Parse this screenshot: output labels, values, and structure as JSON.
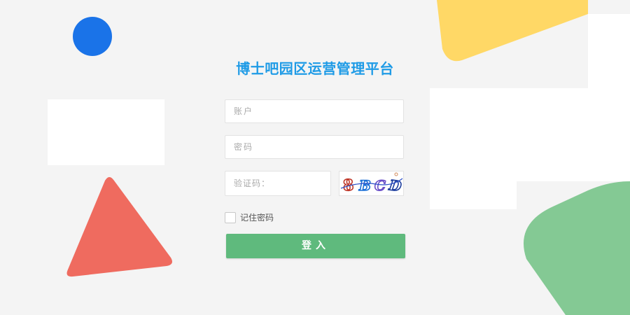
{
  "page": {
    "title": "博士吧园区运营管理平台"
  },
  "form": {
    "account_placeholder": "账户",
    "password_placeholder": "密码",
    "captcha_placeholder": "验证码：",
    "captcha_chars": [
      "8",
      "B",
      "C",
      "D"
    ],
    "remember_label": "记住密码",
    "remember_checked": false,
    "login_label": "登入"
  },
  "colors": {
    "brand_title": "#1f9be6",
    "login_button": "#5fba7d",
    "deco_blue": "#1a73e8",
    "deco_yellow": "#ffd866",
    "deco_red": "#ef6b5f",
    "deco_green": "#84c994"
  }
}
